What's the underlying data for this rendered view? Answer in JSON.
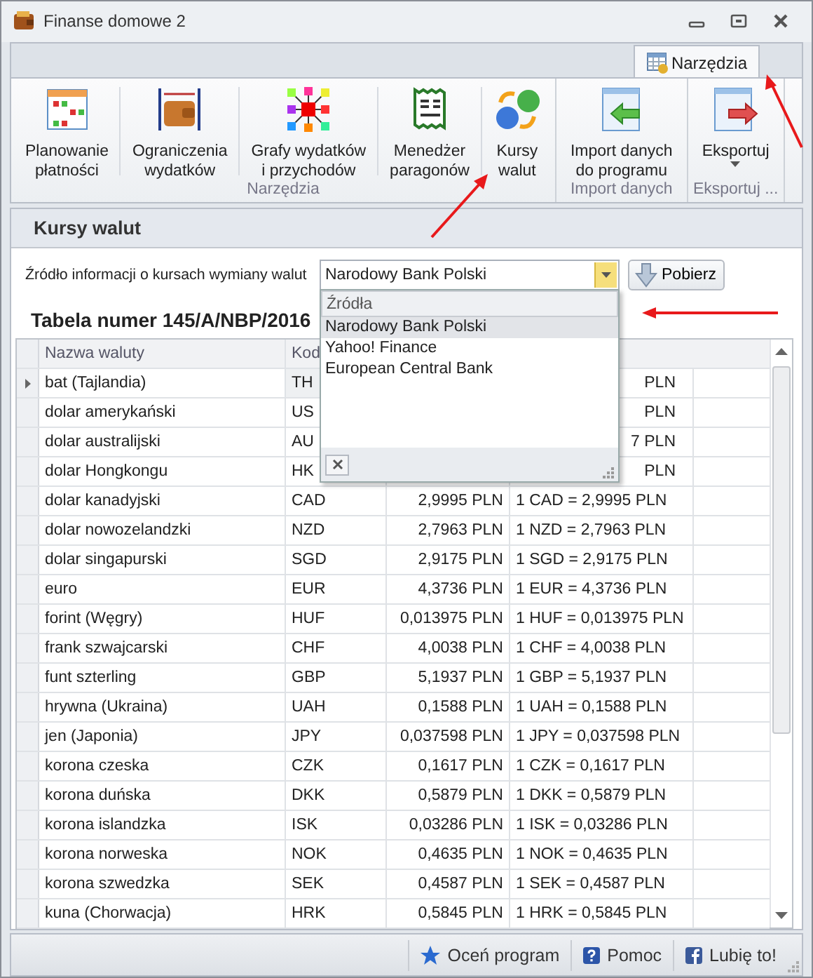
{
  "window": {
    "title": "Finanse domowe 2"
  },
  "ribbon": {
    "tabs": [
      {
        "label": "Narzędzia",
        "selected": true
      }
    ],
    "groups": [
      {
        "label": "Narzędzia",
        "buttons": [
          {
            "label": "Planowanie\npłatności",
            "kind": "calendar"
          },
          {
            "label": "Ograniczenia\nwydatków",
            "kind": "wallet"
          },
          {
            "label": "Grafy wydatków\ni przychodów",
            "kind": "graph"
          },
          {
            "label": "Menedżer\nparagonów",
            "kind": "receipt"
          },
          {
            "label": "Kursy\nwalut",
            "kind": "currency"
          }
        ]
      },
      {
        "label": "Import danych",
        "buttons": [
          {
            "label": "Import danych\ndo programu",
            "kind": "import"
          }
        ]
      },
      {
        "label": "Eksportuj ...",
        "buttons": [
          {
            "label": "Eksportuj",
            "kind": "export",
            "dropdown": true
          }
        ]
      }
    ]
  },
  "section": {
    "title": "Kursy walut"
  },
  "source": {
    "label": "Źródło informacji o kursach wymiany walut",
    "value": "Narodowy Bank Polski",
    "button": "Pobierz",
    "dropdown": {
      "header": "Źródła",
      "options": [
        {
          "label": "Narodowy Bank Polski",
          "selected": true
        },
        {
          "label": "Yahoo! Finance",
          "selected": false
        },
        {
          "label": "European Central Bank",
          "selected": false
        }
      ]
    }
  },
  "table": {
    "title": "Tabela numer 145/A/NBP/2016",
    "columns": [
      "Nazwa waluty",
      "Kod"
    ],
    "rows": [
      {
        "name": "bat (Tajlandia)",
        "code": "TH",
        "rate": "PLN",
        "selected": true
      },
      {
        "name": "dolar amerykański",
        "code": "US",
        "rate": "PLN",
        "selected": false
      },
      {
        "name": "dolar australijski",
        "code": "AU",
        "rate": "7 PLN",
        "selected": false
      },
      {
        "name": "dolar Hongkongu",
        "code": "HK",
        "rate": "PLN",
        "selected": false
      },
      {
        "name": "dolar kanadyjski",
        "code": "CAD",
        "value": "2,9995 PLN",
        "rate": "1 CAD = 2,9995 PLN",
        "selected": false
      },
      {
        "name": "dolar nowozelandzki",
        "code": "NZD",
        "value": "2,7963 PLN",
        "rate": "1 NZD = 2,7963 PLN",
        "selected": false
      },
      {
        "name": "dolar singapurski",
        "code": "SGD",
        "value": "2,9175 PLN",
        "rate": "1 SGD = 2,9175 PLN",
        "selected": false
      },
      {
        "name": "euro",
        "code": "EUR",
        "value": "4,3736 PLN",
        "rate": "1 EUR = 4,3736 PLN",
        "selected": false
      },
      {
        "name": "forint (Węgry)",
        "code": "HUF",
        "value": "0,013975 PLN",
        "rate": "1 HUF = 0,013975 PLN",
        "selected": false
      },
      {
        "name": "frank szwajcarski",
        "code": "CHF",
        "value": "4,0038 PLN",
        "rate": "1 CHF = 4,0038 PLN",
        "selected": false
      },
      {
        "name": "funt szterling",
        "code": "GBP",
        "value": "5,1937 PLN",
        "rate": "1 GBP = 5,1937 PLN",
        "selected": false
      },
      {
        "name": "hrywna (Ukraina)",
        "code": "UAH",
        "value": "0,1588 PLN",
        "rate": "1 UAH = 0,1588 PLN",
        "selected": false
      },
      {
        "name": "jen (Japonia)",
        "code": "JPY",
        "value": "0,037598 PLN",
        "rate": "1 JPY = 0,037598 PLN",
        "selected": false
      },
      {
        "name": "korona czeska",
        "code": "CZK",
        "value": "0,1617 PLN",
        "rate": "1 CZK = 0,1617 PLN",
        "selected": false
      },
      {
        "name": "korona duńska",
        "code": "DKK",
        "value": "0,5879 PLN",
        "rate": "1 DKK = 0,5879 PLN",
        "selected": false
      },
      {
        "name": "korona islandzka",
        "code": "ISK",
        "value": "0,03286 PLN",
        "rate": "1 ISK = 0,03286 PLN",
        "selected": false
      },
      {
        "name": "korona norweska",
        "code": "NOK",
        "value": "0,4635 PLN",
        "rate": "1 NOK = 0,4635 PLN",
        "selected": false
      },
      {
        "name": "korona szwedzka",
        "code": "SEK",
        "value": "0,4587 PLN",
        "rate": "1 SEK = 0,4587 PLN",
        "selected": false
      },
      {
        "name": "kuna (Chorwacja)",
        "code": "HRK",
        "value": "0,5845 PLN",
        "rate": "1 HRK = 0,5845 PLN",
        "selected": false
      }
    ]
  },
  "status_bar": [
    {
      "label": "Oceń program",
      "kind": "star"
    },
    {
      "label": "Pomoc",
      "kind": "help"
    },
    {
      "label": "Lubię to!",
      "kind": "like"
    }
  ]
}
